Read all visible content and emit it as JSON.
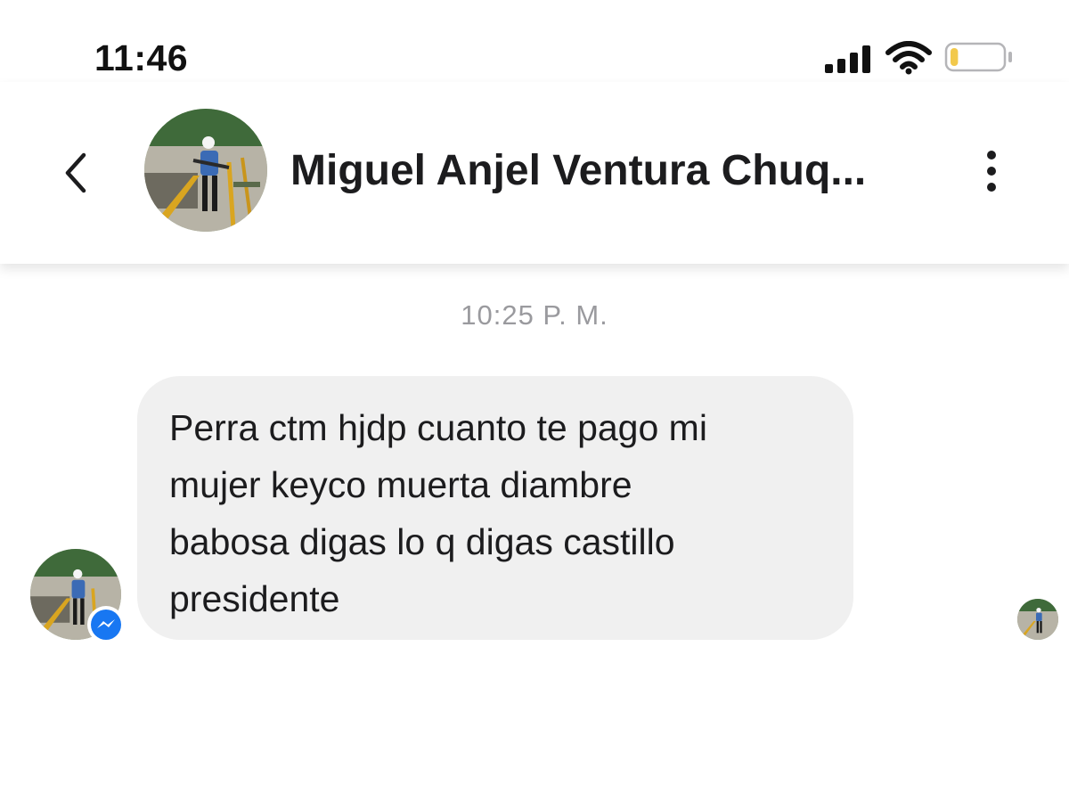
{
  "status_bar": {
    "time": "11:46",
    "icons": [
      "cellular-signal-icon",
      "wifi-icon",
      "battery-icon"
    ],
    "battery_level": 0.15,
    "battery_color": "#f2c94c"
  },
  "header": {
    "back_icon": "chevron-left-icon",
    "contact_name": "Miguel Anjel Ventura Chuq...",
    "more_icon": "vertical-ellipsis-icon",
    "avatar": "contact-photo"
  },
  "conversation": {
    "timestamp": "10:25 P. M.",
    "messages": [
      {
        "lines": [
          "Perra ctm hjdp cuanto te pago mi",
          "mujer keyco muerta diambre",
          "babosa digas lo q digas castillo",
          "presidente"
        ]
      }
    ],
    "badge_icon": "messenger-icon",
    "seen_indicator": "seen-avatar"
  },
  "colors": {
    "bubble": "#f0f0f0",
    "timestamp": "#9a9a9e",
    "messenger_blue": "#1877f2"
  }
}
